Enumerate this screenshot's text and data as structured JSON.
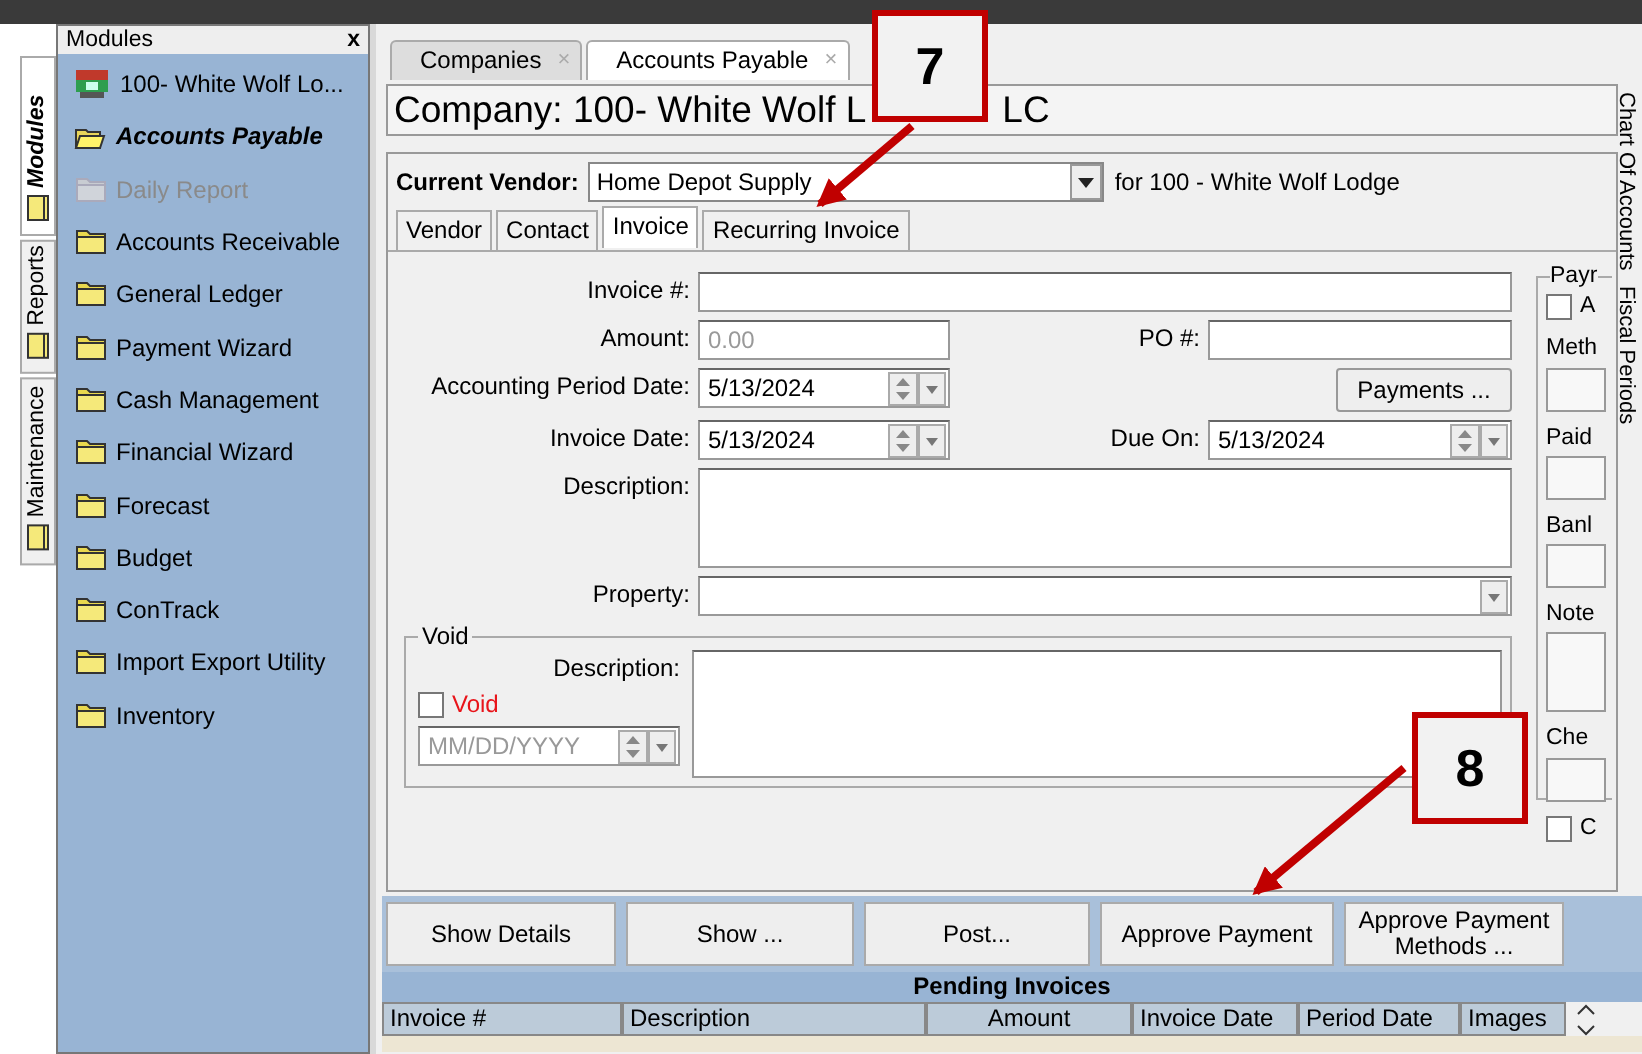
{
  "side_tabs": [
    {
      "label": "Modules",
      "selected": true
    },
    {
      "label": "Reports",
      "selected": false
    },
    {
      "label": "Maintenance",
      "selected": false
    }
  ],
  "modules_panel": {
    "title": "Modules",
    "close": "x",
    "items": [
      {
        "label": "100- White Wolf Lo...",
        "kind": "company",
        "selected": false,
        "disabled": false
      },
      {
        "label": "Accounts Payable",
        "kind": "folder",
        "selected": true,
        "disabled": false
      },
      {
        "label": "Daily Report",
        "kind": "folder",
        "selected": false,
        "disabled": true
      },
      {
        "label": "Accounts Receivable",
        "kind": "folder",
        "selected": false,
        "disabled": false
      },
      {
        "label": "General Ledger",
        "kind": "folder",
        "selected": false,
        "disabled": false
      },
      {
        "label": "Payment Wizard",
        "kind": "folder",
        "selected": false,
        "disabled": false
      },
      {
        "label": "Cash Management",
        "kind": "folder",
        "selected": false,
        "disabled": false
      },
      {
        "label": "Financial Wizard",
        "kind": "folder",
        "selected": false,
        "disabled": false
      },
      {
        "label": "Forecast",
        "kind": "folder",
        "selected": false,
        "disabled": false
      },
      {
        "label": "Budget",
        "kind": "folder",
        "selected": false,
        "disabled": false
      },
      {
        "label": "ConTrack",
        "kind": "folder",
        "selected": false,
        "disabled": false
      },
      {
        "label": "Import Export Utility",
        "kind": "folder",
        "selected": false,
        "disabled": false
      },
      {
        "label": "Inventory",
        "kind": "folder",
        "selected": false,
        "disabled": false
      }
    ]
  },
  "doc_tabs": [
    {
      "label": "Companies",
      "selected": false,
      "close": "×"
    },
    {
      "label": "Accounts Payable",
      "selected": true,
      "close": "×"
    }
  ],
  "company_title": {
    "before_callout": "Company: 100- White Wolf L",
    "after_callout": "LC"
  },
  "vendor": {
    "label": "Current Vendor:",
    "value": "Home Depot Supply",
    "for_text": "for 100 - White Wolf Lodge"
  },
  "sub_tabs": [
    {
      "label": "Vendor",
      "selected": false
    },
    {
      "label": "Contact",
      "selected": false
    },
    {
      "label": "Invoice",
      "selected": true
    },
    {
      "label": "Recurring Invoice",
      "selected": false
    }
  ],
  "invoice_form": {
    "invoice_number": {
      "label": "Invoice #:"
    },
    "amount": {
      "label": "Amount:",
      "placeholder": "0.00"
    },
    "po_number": {
      "label": "PO #:"
    },
    "accounting_period_date": {
      "label": "Accounting Period Date:",
      "value": "5/13/2024"
    },
    "payments_button": "Payments ...",
    "invoice_date": {
      "label": "Invoice Date:",
      "value": "5/13/2024"
    },
    "due_on": {
      "label": "Due On:",
      "value": "5/13/2024"
    },
    "description": {
      "label": "Description:"
    },
    "property": {
      "label": "Property:"
    },
    "void_group": {
      "title": "Void",
      "description_label": "Description:",
      "checkbox": {
        "label": "Void",
        "checked": false
      },
      "date_placeholder": "MM/DD/YYYY"
    }
  },
  "payment_group": {
    "title": "Payr",
    "checkbox": {
      "label": "A",
      "checked": false
    },
    "labels": [
      "Meth",
      "Paid",
      "Banl",
      "Note",
      "Che"
    ],
    "checkbox_2": {
      "label": "C",
      "checked": false
    }
  },
  "right_tabs": [
    "Chart Of Accounts",
    "Fiscal Periods"
  ],
  "buttons": [
    "Show Details",
    "Show ...",
    "Post...",
    "Approve Payment",
    "Approve Payment Methods ..."
  ],
  "pending_invoices": {
    "title": "Pending Invoices",
    "columns": [
      "Invoice #",
      "Description",
      "Amount",
      "Invoice Date",
      "Period Date",
      "Images"
    ]
  },
  "callouts": [
    {
      "label": "7"
    },
    {
      "label": "8"
    }
  ]
}
